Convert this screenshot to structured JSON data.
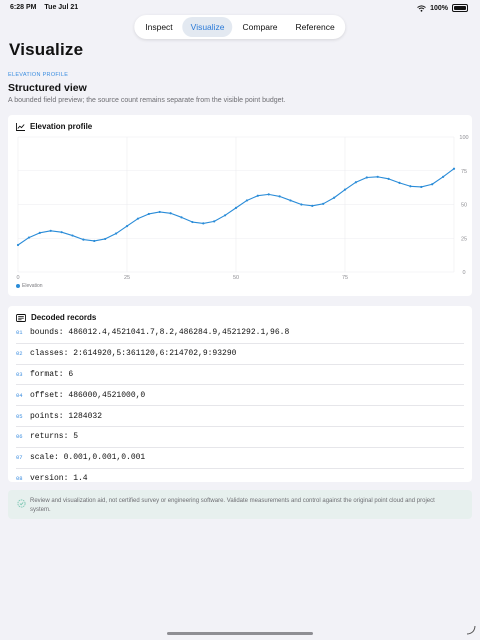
{
  "status": {
    "time": "6:28 PM",
    "date": "Tue Jul 21",
    "battery": "100%"
  },
  "tabs": [
    {
      "label": "Inspect",
      "active": false
    },
    {
      "label": "Visualize",
      "active": true
    },
    {
      "label": "Compare",
      "active": false
    },
    {
      "label": "Reference",
      "active": false
    }
  ],
  "page": {
    "title": "Visualize",
    "eyebrow": "ELEVATION PROFILE",
    "section_title": "Structured view",
    "section_subtitle": "A bounded field preview; the source count remains separate from the visible point budget."
  },
  "chart_card": {
    "title": "Elevation profile",
    "legend": "Elevation"
  },
  "chart_data": {
    "type": "line",
    "title": "Elevation profile",
    "xlabel": "",
    "ylabel": "",
    "xlim": [
      0,
      100
    ],
    "ylim": [
      0,
      100
    ],
    "x_ticks": [
      0,
      25,
      50,
      75
    ],
    "y_ticks": [
      0,
      25,
      50,
      75,
      100
    ],
    "grid": true,
    "legend_position": "bottom-left",
    "series": [
      {
        "name": "Elevation",
        "color": "#2a8cd8",
        "x": [
          0,
          2.5,
          5,
          7.5,
          10,
          12.5,
          15,
          17.5,
          20,
          22.5,
          25,
          27.5,
          30,
          32.5,
          35,
          37.5,
          40,
          42.5,
          45,
          47.5,
          50,
          52.5,
          55,
          57.5,
          60,
          62.5,
          65,
          67.5,
          70,
          72.5,
          75,
          77.5,
          80,
          82.5,
          85,
          87.5,
          90,
          92.5,
          95,
          97.5,
          100
        ],
        "y": [
          20,
          25.5,
          29,
          30.5,
          29.5,
          27,
          24,
          23,
          24.5,
          28.5,
          34,
          39.5,
          43,
          44.5,
          43.5,
          40.5,
          37,
          36,
          37.5,
          42,
          47.5,
          53,
          56.5,
          57.5,
          56,
          53,
          50,
          49,
          50.5,
          55,
          61,
          66.5,
          70,
          70.5,
          69,
          66,
          63.5,
          63,
          65,
          70.5,
          76.5
        ]
      }
    ]
  },
  "records_card": {
    "title": "Decoded records",
    "records": [
      {
        "num": "01",
        "text": "bounds: 486012.4,4521041.7,8.2,486284.9,4521292.1,96.8"
      },
      {
        "num": "02",
        "text": "classes: 2:614920,5:361120,6:214702,9:93290"
      },
      {
        "num": "03",
        "text": "format: 6"
      },
      {
        "num": "04",
        "text": "offset: 486000,4521000,0"
      },
      {
        "num": "05",
        "text": "points: 1284032"
      },
      {
        "num": "06",
        "text": "returns: 5"
      },
      {
        "num": "07",
        "text": "scale: 0.001,0.001,0.001"
      },
      {
        "num": "08",
        "text": "version: 1.4"
      }
    ]
  },
  "disclaimer": "Review and visualization aid, not certified survey or engineering software. Validate measurements and control against the original point cloud and project system."
}
